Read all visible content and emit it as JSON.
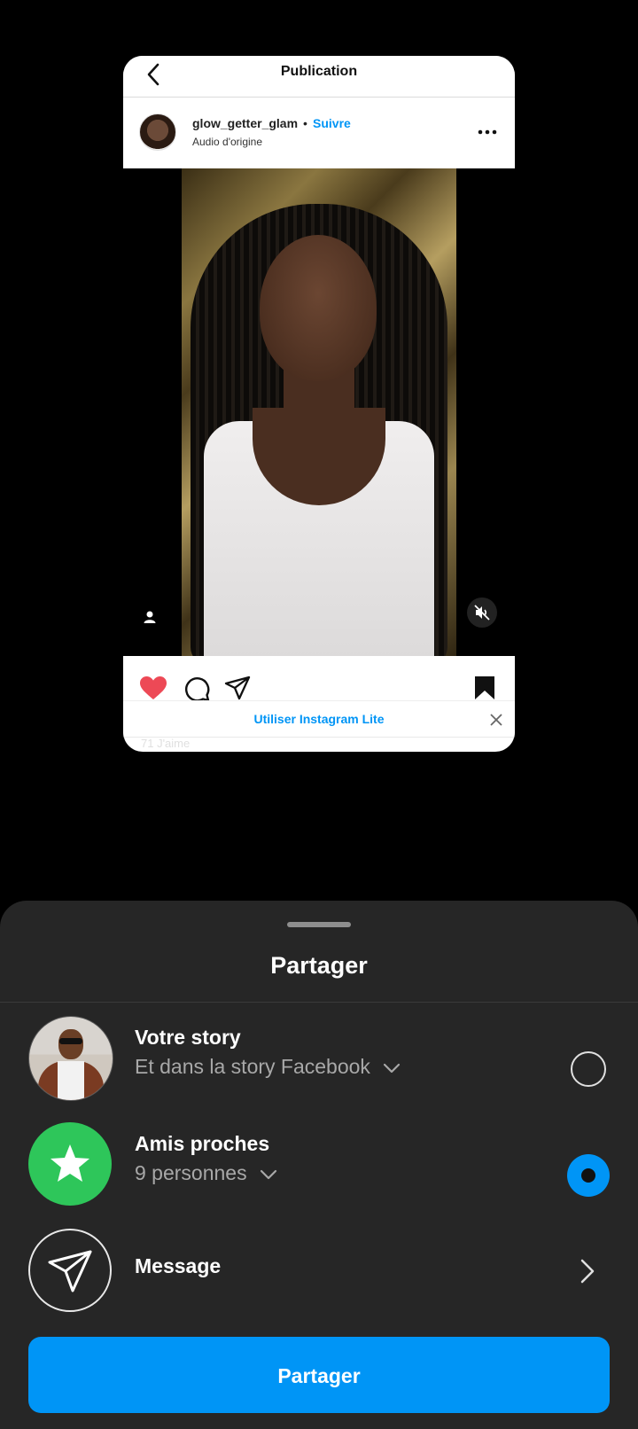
{
  "preview": {
    "title": "Publication",
    "username": "glow_getter_glam",
    "separator": "•",
    "follow_label": "Suivre",
    "audio": "Audio d'origine",
    "lite_banner": "Utiliser Instagram Lite",
    "likes_partial": "71 J'aime"
  },
  "sheet": {
    "title": "Partager",
    "options": [
      {
        "title": "Votre story",
        "subtitle": "Et dans la story Facebook",
        "selected": false
      },
      {
        "title": "Amis proches",
        "subtitle": "9 personnes",
        "selected": true
      },
      {
        "title": "Message"
      }
    ],
    "share_button": "Partager"
  },
  "colors": {
    "accent": "#0095f6",
    "sheet_bg": "#262626",
    "close_friends": "#2ec65a",
    "like": "#ed4956"
  },
  "icons": [
    "back-icon",
    "more-icon",
    "user-tag-icon",
    "mute-icon",
    "heart-icon",
    "comment-icon",
    "share-icon",
    "bookmark-icon",
    "close-icon",
    "star-icon",
    "send-icon",
    "chevron-down-icon",
    "chevron-right-icon"
  ]
}
